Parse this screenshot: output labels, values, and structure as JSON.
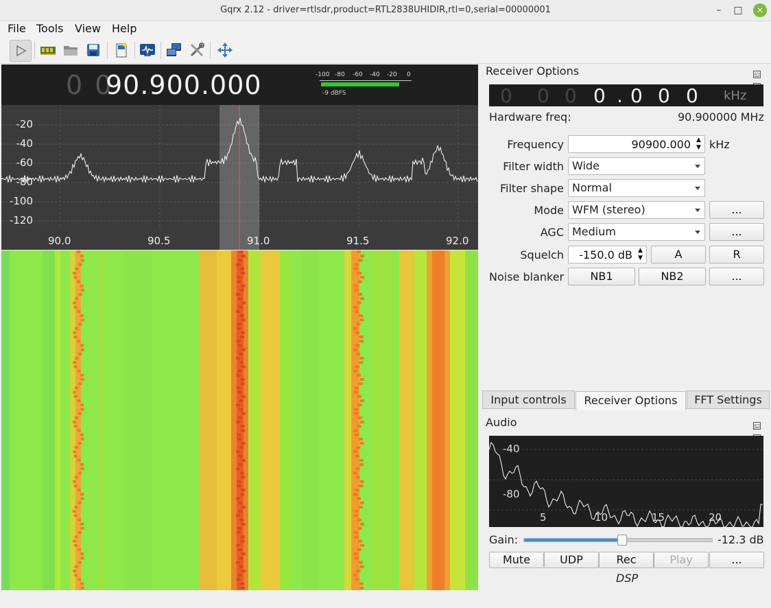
{
  "window": {
    "title": "Gqrx 2.12 - driver=rtlsdr,product=RTL2838UHIDIR,rtl=0,serial=00000001",
    "minimize": "–",
    "maximize": "□",
    "close": "✕"
  },
  "menu": [
    "File",
    "Tools",
    "View",
    "Help"
  ],
  "toolbar": {
    "icons": [
      "play-icon",
      "hardware-icon",
      "open-folder-icon",
      "save-icon",
      "bookmark-icon",
      "display-icon",
      "network-icon",
      "tools-icon",
      "fit-icon"
    ]
  },
  "spectrum": {
    "freq_dim": "0 0",
    "freq_main": "90.900.000",
    "meter_scale": [
      "-100",
      "-80",
      "-60",
      "-40",
      "-20",
      "0"
    ],
    "meter_level_pct": 0.85,
    "meter_readout": "-9 dBFS",
    "y_ticks": [
      "-20",
      "-40",
      "-60",
      "-80",
      "-100",
      "-120"
    ],
    "x_ticks": [
      "90.0",
      "90.5",
      "91.0",
      "91.5",
      "92.0"
    ],
    "center_freq_mhz": 90.9,
    "colors": {
      "waterfall_bg": "#8ee84a",
      "trace": "#ffffff",
      "marker": "#ff5050"
    }
  },
  "receiver_options": {
    "title": "Receiver Options",
    "lcd_digits_dim": [
      "0",
      "0",
      "0"
    ],
    "lcd_digits_bright": [
      "0",
      ".",
      "0",
      "0",
      "0"
    ],
    "lcd_unit": "kHz",
    "hw_freq_label": "Hardware freq:",
    "hw_freq_value": "90.900000 MHz",
    "frequency_label": "Frequency",
    "frequency_value": "90900.000",
    "frequency_unit": "kHz",
    "filter_width_label": "Filter width",
    "filter_width_value": "Wide",
    "filter_shape_label": "Filter shape",
    "filter_shape_value": "Normal",
    "mode_label": "Mode",
    "mode_value": "WFM (stereo)",
    "agc_label": "AGC",
    "agc_value": "Medium",
    "squelch_label": "Squelch",
    "squelch_value": "-150.0 dB",
    "squelch_a": "A",
    "squelch_r": "R",
    "noise_blanker_label": "Noise blanker",
    "nb1": "NB1",
    "nb2": "NB2",
    "more": "..."
  },
  "tabs": [
    "Input controls",
    "Receiver Options",
    "FFT Settings"
  ],
  "audio": {
    "title": "Audio",
    "y_ticks": [
      "-40",
      "-80"
    ],
    "x_ticks": [
      "5",
      "10",
      "15",
      "20"
    ],
    "gain_label": "Gain:",
    "gain_value": "-12.3 dB",
    "gain_level_pct": 0.52,
    "buttons": [
      "Mute",
      "UDP",
      "Rec",
      "Play",
      "..."
    ],
    "dsp_label": "DSP"
  }
}
